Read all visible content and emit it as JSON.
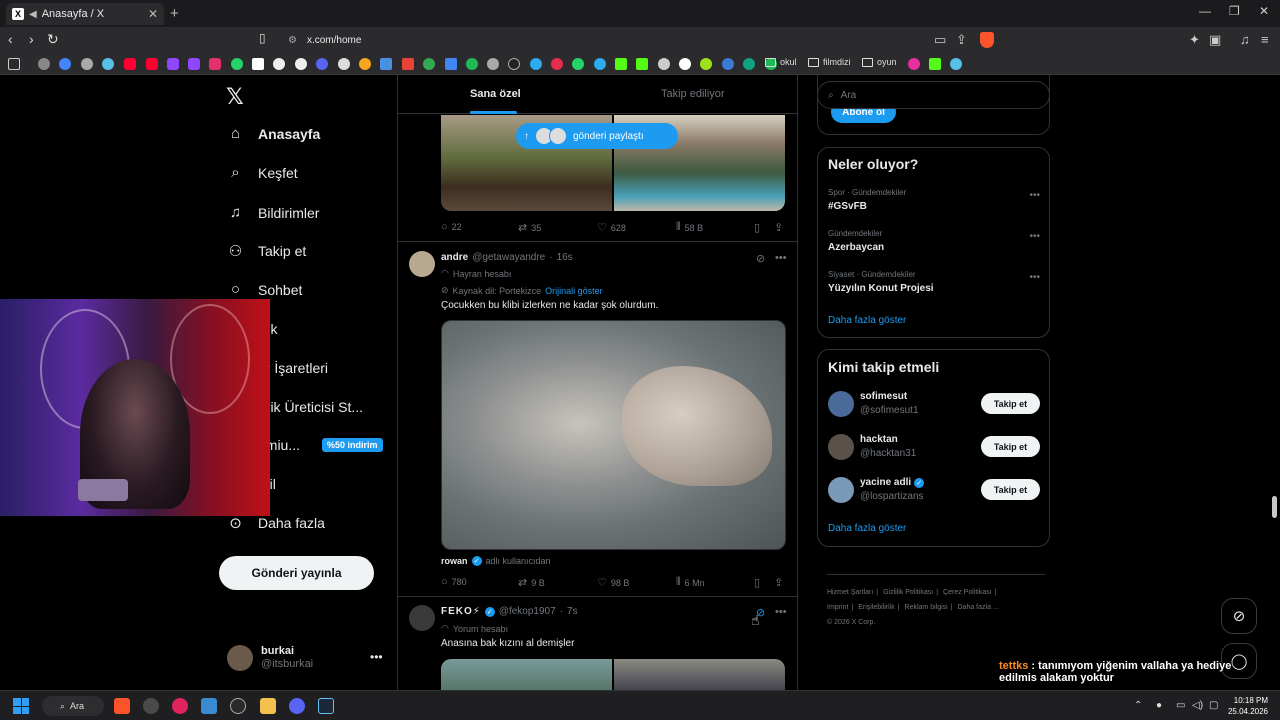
{
  "browser": {
    "tab_title": "Anasayfa / X",
    "url": "x.com/home",
    "bookmark_folders": [
      "okul",
      "filmdizi",
      "oyun"
    ]
  },
  "sidebar": {
    "items": [
      {
        "label": "Anasayfa",
        "icon": "home-icon"
      },
      {
        "label": "Keşfet",
        "icon": "search-icon"
      },
      {
        "label": "Bildirimler",
        "icon": "bell-icon"
      },
      {
        "label": "Takip et",
        "icon": "add-user-icon"
      },
      {
        "label": "Sohbet",
        "icon": "chat-icon"
      },
      {
        "label": "rok",
        "icon": "grok-icon"
      },
      {
        "label": "er İşaretleri",
        "icon": "bookmark-icon"
      },
      {
        "label": "erik Üreticisi St...",
        "icon": "creator-studio-icon"
      },
      {
        "label": "emiu...",
        "icon": "premium-icon"
      },
      {
        "label": "ofil",
        "icon": "profile-icon"
      },
      {
        "label": "Daha fazla",
        "icon": "more-icon"
      }
    ],
    "premium_badge": "%50 indirim",
    "post_button": "Gönderi yayınla",
    "account": {
      "name": "burkai",
      "handle": "@itsburkai"
    }
  },
  "feed": {
    "tabs": [
      "Sana özel",
      "Takip ediliyor"
    ],
    "share_pill": "gönderi paylaştı",
    "post1_stats": {
      "replies": "22",
      "reposts": "35",
      "likes": "628",
      "views": "58 B"
    },
    "post2": {
      "name": "andre",
      "handle": "@getawayandre",
      "time": "16s",
      "label": "Hayran hesabı",
      "source_lang": "Kaynak dil: Portekizce",
      "show_original": "Orijinali göster",
      "text": "Çocukken bu klibi izlerken ne kadar şok olurdum.",
      "video_user": "rowan",
      "video_source": "adlı kullanıcıdan",
      "stats": {
        "replies": "780",
        "reposts": "9 B",
        "likes": "98 B",
        "views": "6 Mn"
      }
    },
    "post3": {
      "name": "FEKO⚡",
      "handle": "@fekop1907",
      "time": "7s",
      "label": "Yorum hesabı",
      "text": "Anasına bak kızını al demişler"
    }
  },
  "right": {
    "search_placeholder": "Ara",
    "subscribe_button": "Abone ol",
    "trends_title": "Neler oluyor?",
    "trends": [
      {
        "category": "Spor · Gündemdekiler",
        "topic": "#GSvFB"
      },
      {
        "category": "Gündemdekiler",
        "topic": "Azerbaycan"
      },
      {
        "category": "Siyaset · Gündemdekiler",
        "topic": "Yüzyılın Konut Projesi"
      }
    ],
    "trends_show_more": "Daha fazla göster",
    "who_title": "Kimi takip etmeli",
    "who": [
      {
        "name": "sofimesut",
        "handle": "@sofimesut1",
        "button": "Takip et"
      },
      {
        "name": "hacktan",
        "handle": "@hacktan31",
        "button": "Takip et"
      },
      {
        "name": "yacine adli",
        "handle": "@lospartizans",
        "button": "Takip et"
      }
    ],
    "who_show_more": "Daha fazla göster",
    "footer": [
      "Hizmet Şartları",
      "Gizlilik Politikası",
      "Çerez Politikası",
      "Imprint",
      "Erişilebilirlik",
      "Reklam bilgisi",
      "Daha fazla ...",
      "© 2026 X Corp."
    ]
  },
  "chat": {
    "line1_user": "tettks",
    "line1_text": ": tanımıyom yiğenim vallaha ya hediye edilmis alakam yoktur",
    "line2_user": "tettks",
    "line2_text": ":"
  },
  "taskbar": {
    "search": "Ara",
    "time": "10:18 PM",
    "date": "25.04.2026"
  }
}
